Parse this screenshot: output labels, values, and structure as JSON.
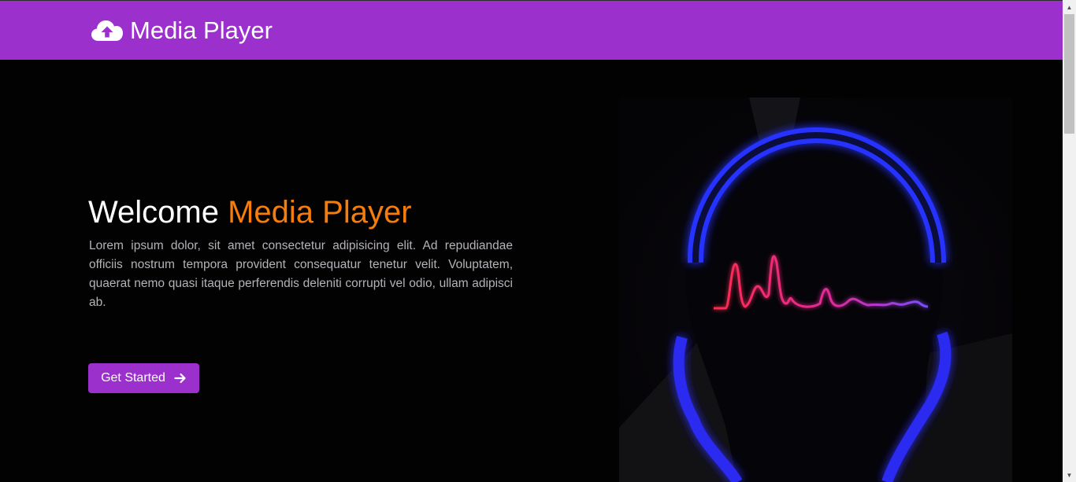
{
  "navbar": {
    "brand_icon": "cloud-upload-icon",
    "brand_text": "Media Player",
    "color": "#9b30cc"
  },
  "hero": {
    "title_prefix": "Welcome",
    "title_highlight": "Media Player",
    "highlight_color": "#f47d0c",
    "description": "Lorem ipsum dolor, sit amet consectetur adipisicing elit. Ad repudiandae officiis nostrum tempora provident consequatur tenetur velit. Voluptatem, quaerat nemo quasi itaque perferendis deleniti corrupti vel odio, ullam adipisci ab.",
    "cta_label": "Get Started",
    "cta_icon": "arrow-right-icon",
    "art_image": "headphones-soundwave-illustration"
  },
  "scrollbar": {
    "up_icon": "scroll-up-arrow-icon",
    "down_icon": "scroll-down-arrow-icon"
  }
}
